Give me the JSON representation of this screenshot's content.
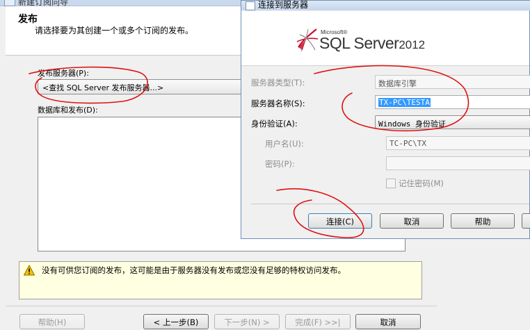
{
  "wizard": {
    "window_title": "新建订阅向导",
    "header_title": "发布",
    "header_subtitle": "请选择要为其创建一个或多个订阅的发布。",
    "publisher_label": "发布服务器(P):",
    "publisher_combo_value": "<查找 SQL Server 发布服务器...>",
    "databases_label": "数据库和发布(D):",
    "warning_text": "没有可供您订阅的发布，这可能是由于服务器没有发布或您没有足够的特权访问发布。",
    "buttons": {
      "help": "帮助(H)",
      "back": "< 上一步(B)",
      "next": "下一步(N) >",
      "finish": "完成(F) >>|",
      "cancel": "取消"
    }
  },
  "connect_dialog": {
    "title": "连接到服务器",
    "logo_company": "Microsoft®",
    "logo_product": "SQL Server",
    "logo_version": "2012",
    "server_type_label": "服务器类型(T):",
    "server_type_value": "数据库引擎",
    "server_name_label": "服务器名称(S):",
    "server_name_value": "TX-PC\\TESTA",
    "auth_label": "身份验证(A):",
    "auth_value": "Windows 身份验证",
    "username_label": "用户名(U):",
    "username_value": "TC-PC\\TX",
    "password_label": "密码(P):",
    "password_value": "",
    "remember_label": "记住密码(M)",
    "buttons": {
      "connect": "连接(C)",
      "cancel": "取消",
      "help": "帮助"
    }
  },
  "colors": {
    "annotation_red": "#e01010",
    "selection_blue": "#3399ff",
    "warning_bg": "#ffffe1"
  }
}
